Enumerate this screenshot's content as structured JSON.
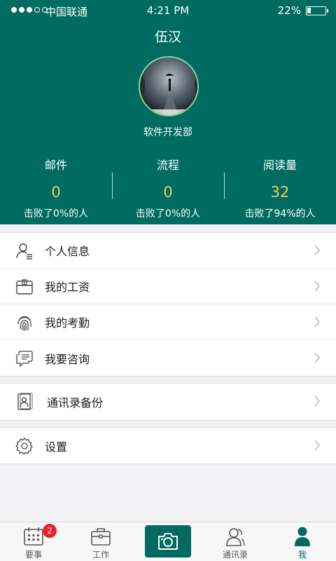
{
  "status_bar": {
    "carrier": "中国联通",
    "time": "4:21 PM",
    "battery_percent": "22%",
    "battery_level": 0.22,
    "signal_bars": 3
  },
  "profile": {
    "name": "伍汉",
    "department": "软件开发部",
    "avatar": "avatar-photo"
  },
  "stats": [
    {
      "label": "邮件",
      "value": "0",
      "sub": "击败了0%的人"
    },
    {
      "label": "流程",
      "value": "0",
      "sub": "击败了0%的人"
    },
    {
      "label": "阅读量",
      "value": "32",
      "sub": "击败了94%的人"
    }
  ],
  "menu_groups": [
    {
      "items": [
        {
          "label": "个人信息",
          "icon": "person-info-icon"
        },
        {
          "label": "我的工资",
          "icon": "wallet-icon"
        },
        {
          "label": "我的考勤",
          "icon": "fingerprint-icon"
        },
        {
          "label": "我要咨询",
          "icon": "chat-icon"
        }
      ]
    },
    {
      "items": [
        {
          "label": "通讯录备份",
          "icon": "contacts-backup-icon"
        }
      ]
    },
    {
      "items": [
        {
          "label": "设置",
          "icon": "gear-icon"
        }
      ]
    }
  ],
  "tabbar": {
    "tabs": [
      {
        "label": "要事",
        "icon": "calendar-icon",
        "badge": "2"
      },
      {
        "label": "工作",
        "icon": "briefcase-icon"
      },
      {
        "label": "",
        "icon": "camera-icon"
      },
      {
        "label": "通讯录",
        "icon": "contacts-icon"
      },
      {
        "label": "我",
        "icon": "profile-icon",
        "active": true
      }
    ]
  },
  "colors": {
    "primary": "#006b61",
    "stat_value": "#f1c75b",
    "badge": "#e8232a"
  }
}
